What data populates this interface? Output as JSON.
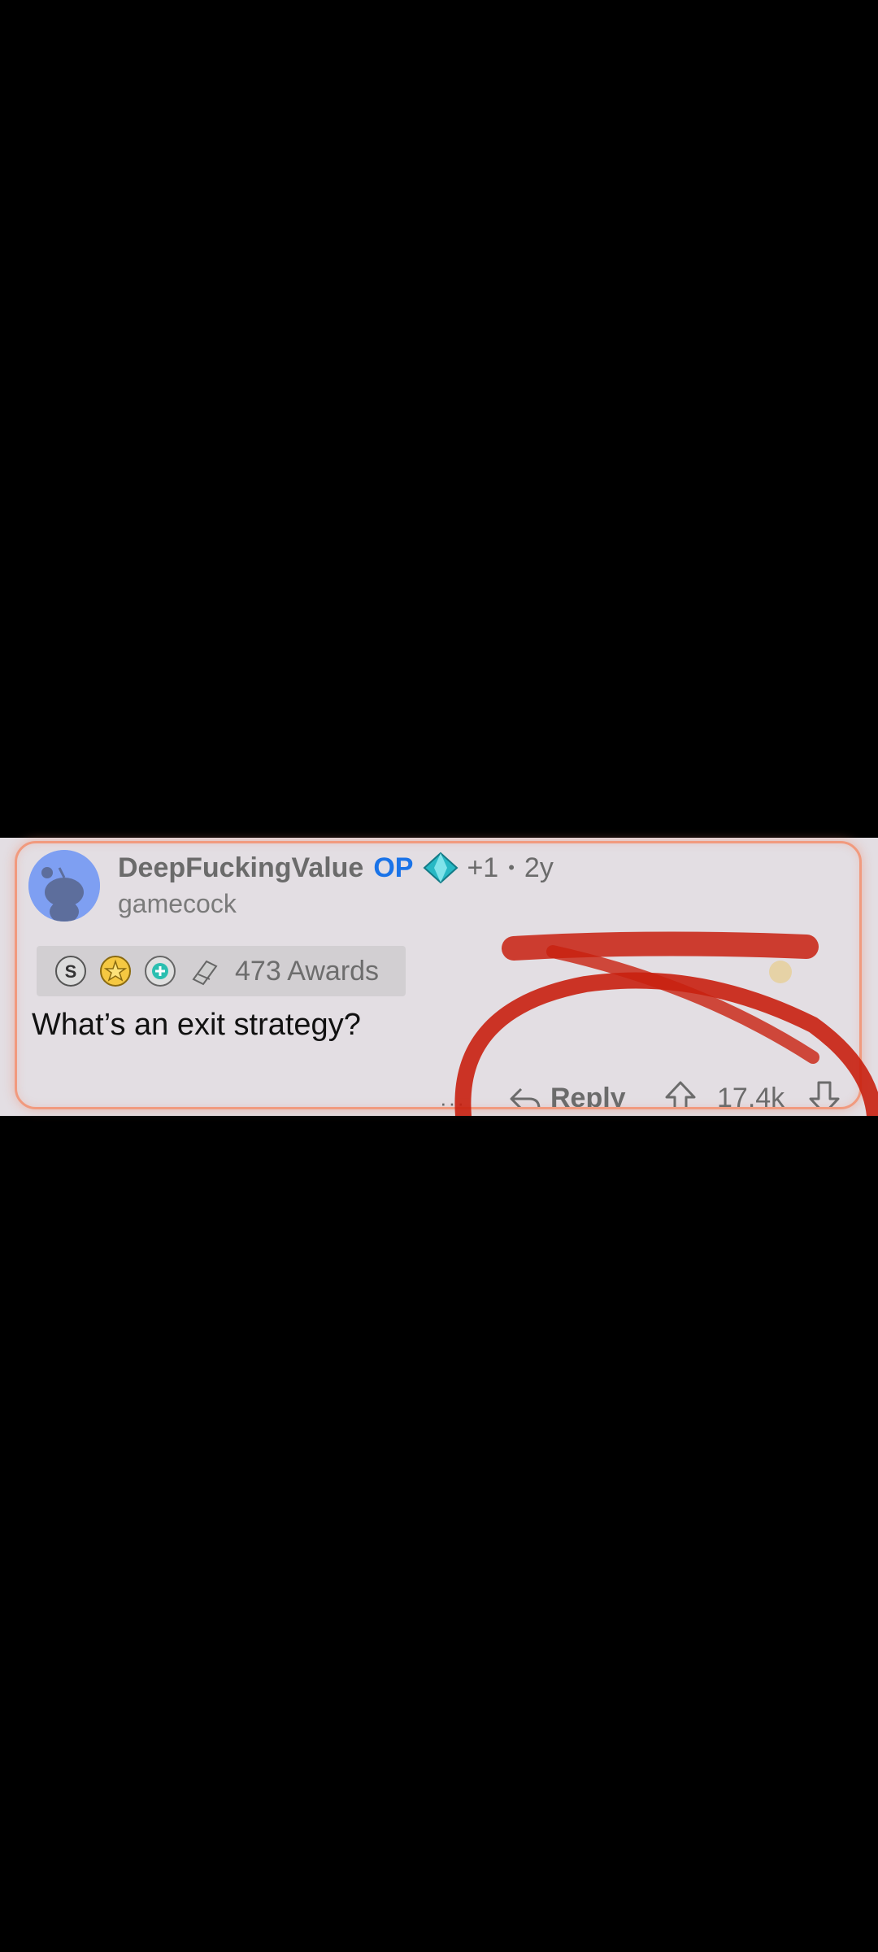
{
  "comment": {
    "username": "DeepFuckingValue",
    "op_badge": "OP",
    "flair_icon": "diamond-hands-icon",
    "plus": "+1",
    "separator": "•",
    "age": "2y",
    "user_flair": "gamecock",
    "awards_label": "473 Awards",
    "body": "What’s an exit strategy?"
  },
  "actions": {
    "more": "···",
    "reply": "Reply",
    "score": "17.4k"
  },
  "colors": {
    "op": "#1a73e8",
    "highlight_border": "#f19a7e",
    "scribble": "#c8200f",
    "avatar_bg": "#7e9ff2"
  }
}
